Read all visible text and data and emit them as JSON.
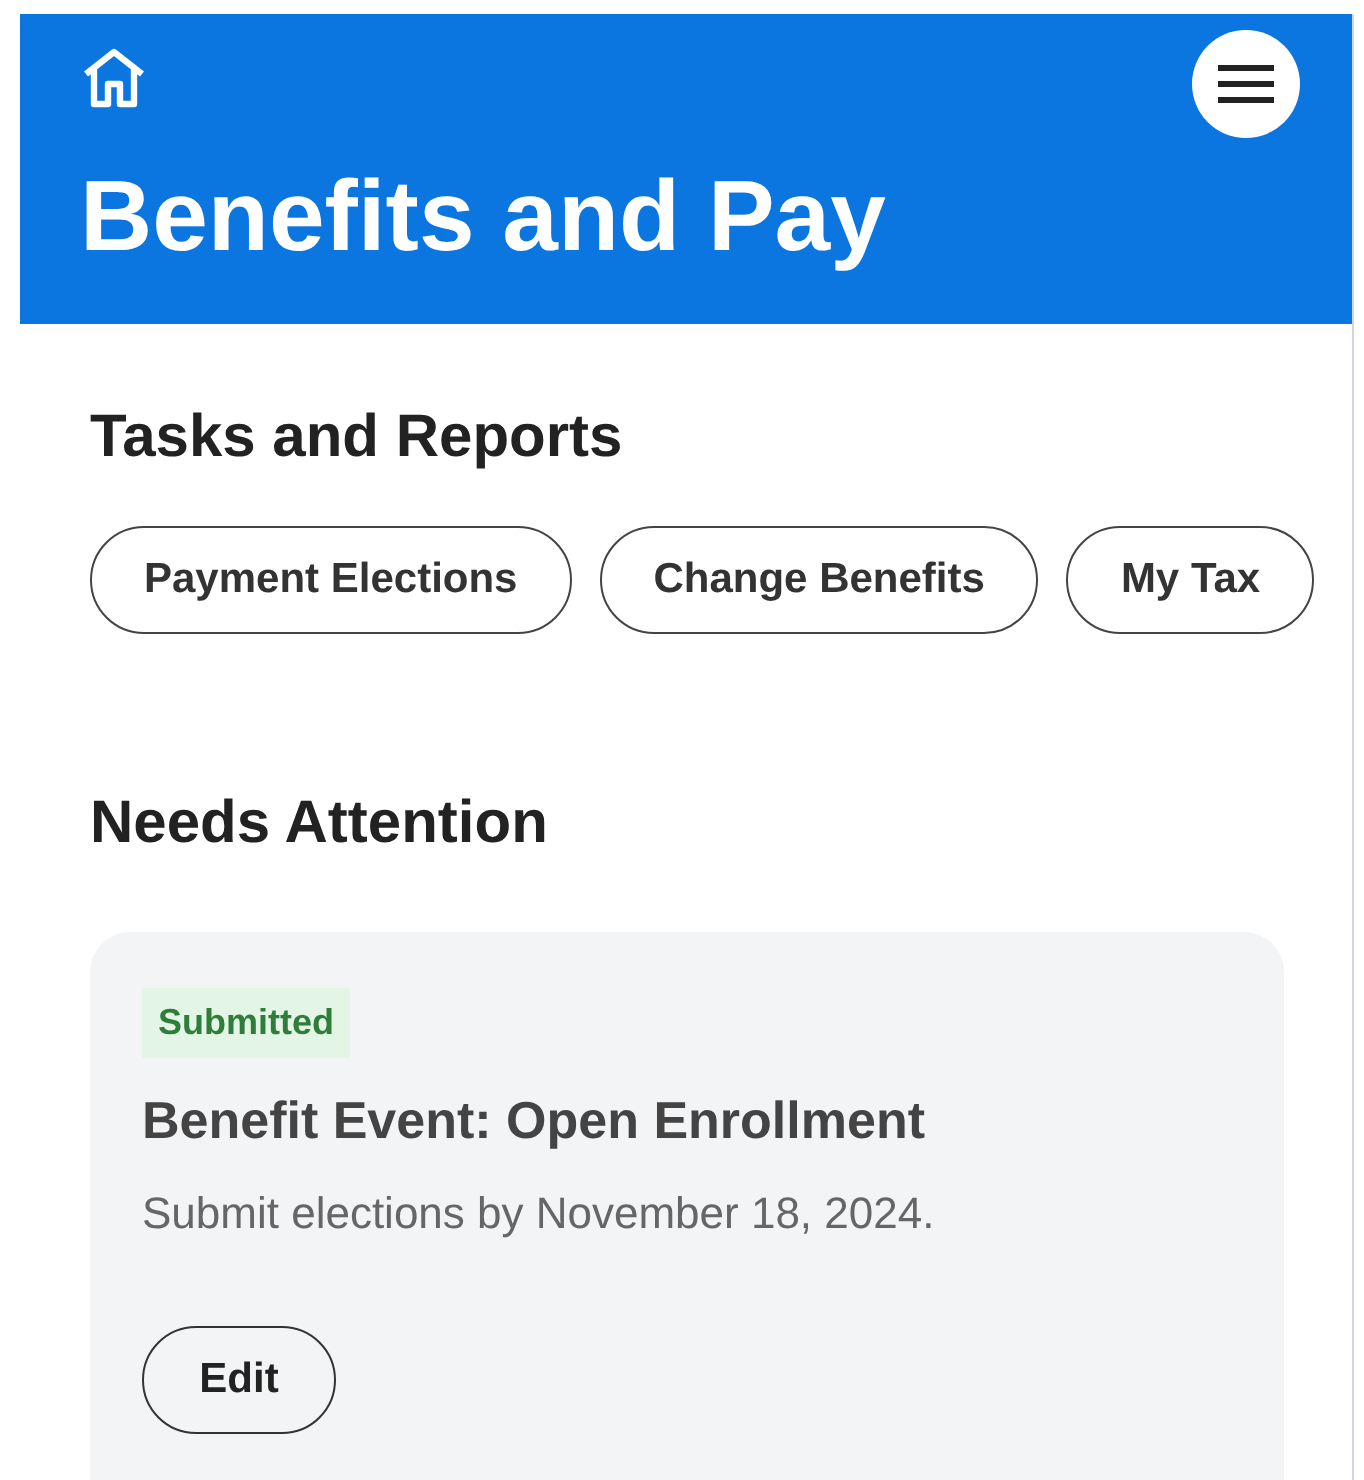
{
  "header": {
    "title": "Benefits and Pay"
  },
  "tasks_and_reports": {
    "heading": "Tasks and Reports",
    "chips": [
      "Payment Elections",
      "Change Benefits",
      "My Tax"
    ]
  },
  "needs_attention": {
    "heading": "Needs Attention",
    "cards": [
      {
        "status": "Submitted",
        "title": "Benefit Event: Open Enrollment",
        "subtitle": "Submit elections by November 18, 2024.",
        "action": "Edit"
      }
    ]
  }
}
